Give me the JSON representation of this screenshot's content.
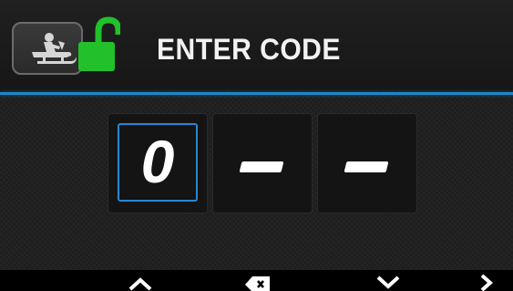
{
  "header": {
    "title": "ENTER CODE",
    "vehicle_icon": "snowmobile-icon",
    "lock_icon": "lock-open-icon",
    "lock_color": "#22c02a"
  },
  "code": {
    "digits": [
      "0",
      "",
      ""
    ],
    "active_index": 0,
    "active_color": "#2a86d0"
  },
  "accent_color": "#1e86c8",
  "footer": {
    "buttons": [
      {
        "icon": "chevron-up-icon"
      },
      {
        "icon": "backspace-icon"
      },
      {
        "icon": "chevron-down-icon"
      },
      {
        "icon": "chevron-right-icon"
      }
    ]
  }
}
